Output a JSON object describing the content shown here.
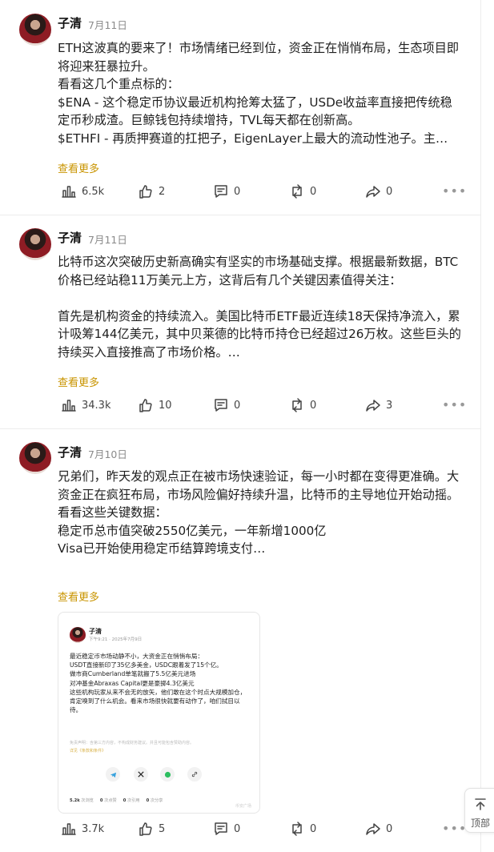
{
  "posts": [
    {
      "author": "子清",
      "date": "7月11日",
      "body": "ETH这波真的要来了！市场情绪已经到位，资金正在悄悄布局，生态项目即将迎来狂暴拉升。\n看看这几个重点标的：\n$ENA - 这个稳定币协议最近机构抢筹太猛了，USDe收益率直接把传统稳定币秒成渣。巨鲸钱包持续增持，TVL每天都在创新高。\n$ETHFI - 再质押赛道的扛把子，EigenLayer上最大的流动性池子。主…",
      "more": "查看更多",
      "stats": {
        "views": "6.5k",
        "likes": "2",
        "comments": "0",
        "reposts": "0",
        "shares": "0"
      }
    },
    {
      "author": "子清",
      "date": "7月11日",
      "body": "比特币这次突破历史新高确实有坚实的市场基础支撑。根据最新数据，BTC价格已经站稳11万美元上方，这背后有几个关键因素值得关注：\n\n首先是机构资金的持续流入。美国比特币ETF最近连续18天保持净流入，累计吸筹144亿美元，其中贝莱德的比特币持仓已经超过26万枚。这些巨头的持续买入直接推高了市场价格。…",
      "more": "查看更多",
      "stats": {
        "views": "34.3k",
        "likes": "10",
        "comments": "0",
        "reposts": "0",
        "shares": "3"
      }
    },
    {
      "author": "子清",
      "date": "7月10日",
      "body": "兄弟们，昨天发的观点正在被市场快速验证，每一小时都在变得更准确。大资金正在疯狂布局，市场风险偏好持续升温，比特币的主导地位开始动摇。\n看看这些关键数据：\n稳定币总市值突破2550亿美元，一年新增1000亿\nVisa已开始使用稳定币结算跨境支付…",
      "more": "查看更多",
      "stats": {
        "views": "3.7k",
        "likes": "5",
        "comments": "0",
        "reposts": "0",
        "shares": "0"
      },
      "card": {
        "author": "子清",
        "meta": "下午9:21 · 2025年7月9日",
        "body": "最近稳定币市场动静不小，大资金正在悄悄布局：\nUSDT直接新印了35亿多美金，USDC跟着发了15个亿。\n做市商Cumberland单笔就搬了5.5亿美元进场\n对冲基金Abraxas Capital更是豪掷4.3亿美元\n这些机构玩家从来不会无的放矢，他们敢在这个时点大规模加仓，肯定嗅到了什么机会。看来市场很快就要有动作了，咱们拭目以待。",
        "note": "免责声明：含第三方内容，不构成财务建议。并且可能包含赞助内容。",
        "note_link": "详见《条款和条件》",
        "stats": [
          {
            "value": "5.2k",
            "label": "次浏览"
          },
          {
            "value": "0",
            "label": "次点赞"
          },
          {
            "value": "0",
            "label": "次引用"
          },
          {
            "value": "0",
            "label": "次分享"
          }
        ],
        "watermark": "币安广场"
      }
    }
  ],
  "back_to_top": "顶部",
  "colors": {
    "link": "#c99400",
    "muted": "#8a8a8a"
  }
}
